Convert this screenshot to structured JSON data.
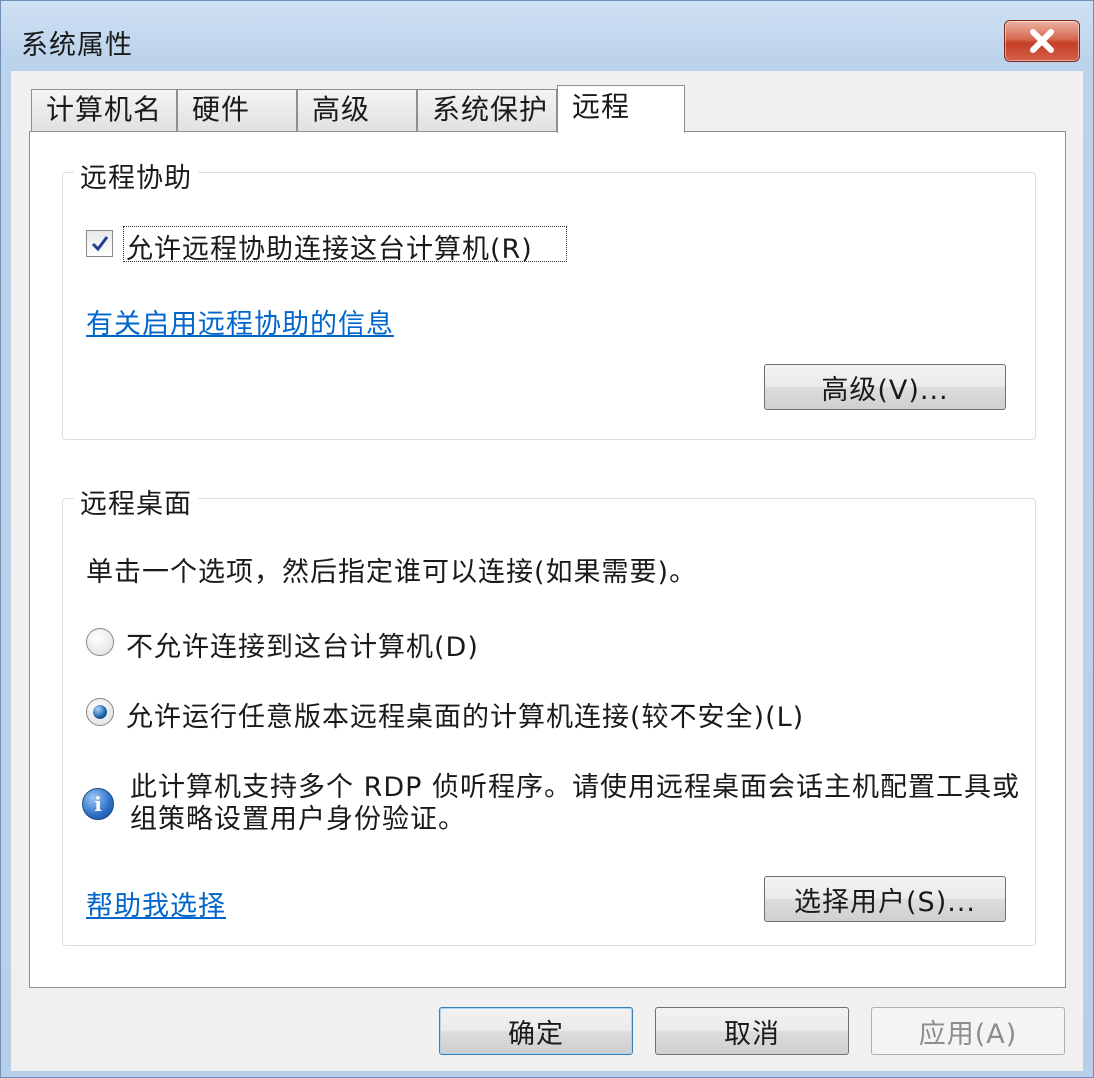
{
  "window": {
    "title": "系统属性"
  },
  "tabs": [
    {
      "label": "计算机名"
    },
    {
      "label": "硬件"
    },
    {
      "label": "高级"
    },
    {
      "label": "系统保护"
    },
    {
      "label": "远程"
    }
  ],
  "remote_assistance": {
    "group_title": "远程协助",
    "allow_checkbox_label": "允许远程协助连接这台计算机(R)",
    "allow_checked": true,
    "info_link": "有关启用远程协助的信息",
    "advanced_button": "高级(V)..."
  },
  "remote_desktop": {
    "group_title": "远程桌面",
    "instruction": "单击一个选项，然后指定谁可以连接(如果需要)。",
    "option_deny": "不允许连接到这台计算机(D)",
    "option_allow_any": "允许运行任意版本远程桌面的计算机连接(较不安全)(L)",
    "selected_option": "allow_any",
    "info_text": "此计算机支持多个 RDP 侦听程序。请使用远程桌面会话主机配置工具或组策略设置用户身份验证。",
    "help_link": "帮助我选择",
    "select_users_button": "选择用户(S)..."
  },
  "footer": {
    "ok_button": "确定",
    "cancel_button": "取消",
    "apply_button": "应用(A)"
  }
}
